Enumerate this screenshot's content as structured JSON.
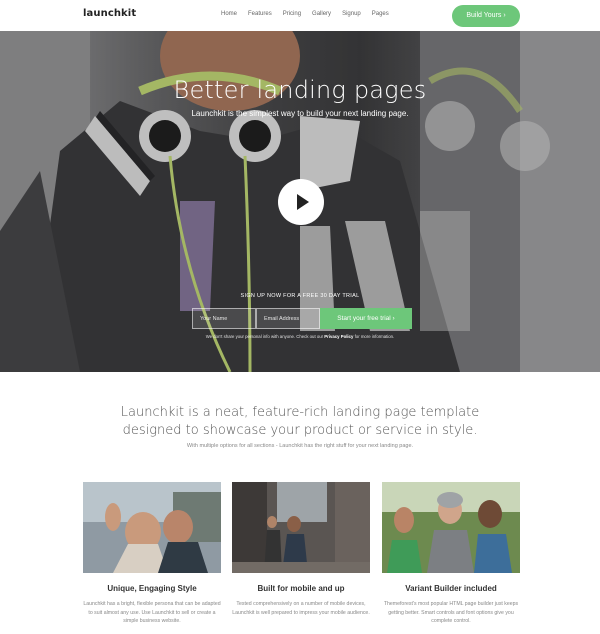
{
  "header": {
    "logo": "launchkit",
    "nav": [
      "Home",
      "Features",
      "Pricing",
      "Gallery",
      "Signup",
      "Pages"
    ],
    "cta": "Build Yours ›"
  },
  "hero": {
    "title": "Better landing pages",
    "subtitle": "Launchkit is the simplest way to build your next landing page.",
    "signup_label": "SIGN UP NOW FOR A FREE 30 DAY TRIAL",
    "name_placeholder": "Your Name",
    "email_placeholder": "Email Address",
    "submit": "Start your free trial ›",
    "privacy_text": "We don't share your personal info with anyone. Check out our",
    "privacy_link": "Privacy Policy",
    "privacy_tail": "for more information."
  },
  "intro": {
    "title": "Launchkit is a neat, feature-rich landing page template designed to showcase your product or service in style.",
    "subtitle": "With multiple options for all sections - Launchkit has the right stuff for your next landing page."
  },
  "features": [
    {
      "title": "Unique, Engaging Style",
      "text": "Launchkit has a bright, flexible persona that can be adapted to suit almost any use. Use Launchkit to sell or create a simple business website."
    },
    {
      "title": "Built for mobile and up",
      "text": "Tested comprehensively on a number of mobile devices, Launchkit is well prepared to impress your mobile audience."
    },
    {
      "title": "Variant Builder included",
      "text": "Themeforest's most popular HTML page builder just keeps getting better. Smart controls and font options give you complete control."
    }
  ],
  "colors": {
    "accent": "#6dc77a",
    "heading": "#333333",
    "muted": "#888888"
  }
}
